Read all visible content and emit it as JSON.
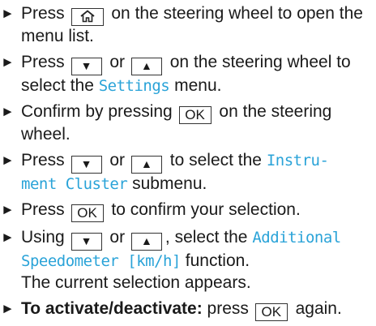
{
  "steps": [
    {
      "bullet": "►",
      "pre": "Press",
      "post": "on the steering wheel to open the menu list."
    },
    {
      "bullet": "►",
      "pre": "Press",
      "or": "or",
      "menu_pre": "on the steering wheel to select the",
      "menu_name": "Settings",
      "post": "menu."
    },
    {
      "bullet": "►",
      "pre": "Confirm by pressing",
      "ok": "OK",
      "post": "on the steering wheel."
    },
    {
      "bullet": "►",
      "pre": "Press",
      "or": "or",
      "mid": "to select the",
      "menu_name_1": "Instru-",
      "menu_name_2": "ment Cluster",
      "post": "submenu."
    },
    {
      "bullet": "►",
      "pre": "Press",
      "ok": "OK",
      "post": "to confirm your selection."
    },
    {
      "bullet": "►",
      "pre": "Using",
      "or": "or",
      "mid": ", select the",
      "func_1": "Additional",
      "func_2": "Speedometer [km/h]",
      "post": "function.",
      "note": "The current selection appears."
    },
    {
      "bullet": "►",
      "bold": "To activate/deactivate:",
      "pre": "press",
      "ok": "OK",
      "post": "again."
    }
  ],
  "keys": {
    "down": "▼",
    "up": "▲",
    "home_icon": "home-icon"
  },
  "colors": {
    "accent": "#2aa3d8",
    "text": "#1a1a1a"
  }
}
